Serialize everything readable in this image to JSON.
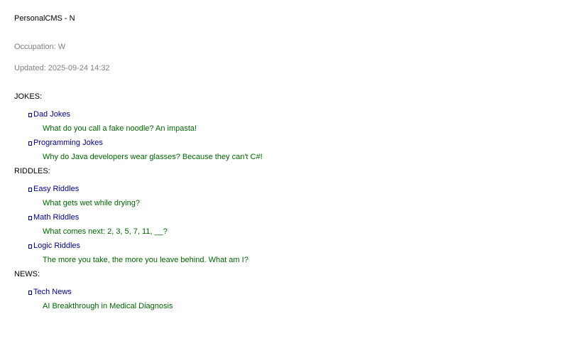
{
  "app": {
    "title": "PersonalCMS - N"
  },
  "profile": {
    "occupation": "Occupation: W",
    "updated": "Updated: 2025-09-24 14:32"
  },
  "categories": [
    {
      "label": "JOKES:",
      "subcategories": [
        {
          "label": "Dad Jokes",
          "entry": "What do you call a fake noodle? An impasta!"
        },
        {
          "label": "Programming Jokes",
          "entry": "Why do Java developers wear glasses? Because they can't C#!"
        }
      ]
    },
    {
      "label": "RIDDLES:",
      "subcategories": [
        {
          "label": "Easy Riddles",
          "entry": "What gets wet while drying?"
        },
        {
          "label": "Math Riddles",
          "entry": "What comes next: 2, 3, 5, 7, 11, __?"
        },
        {
          "label": "Logic Riddles",
          "entry": "The more you take, the more you leave behind. What am I?"
        }
      ]
    },
    {
      "label": "NEWS:",
      "subcategories": [
        {
          "label": "Tech News",
          "entry": "AI Breakthrough in Medical Diagnosis"
        }
      ]
    }
  ],
  "icons": {
    "subcategory_marker": "folder-icon"
  },
  "colors": {
    "subcategory": "#000080",
    "entry": "#006400",
    "meta": "#808080"
  }
}
